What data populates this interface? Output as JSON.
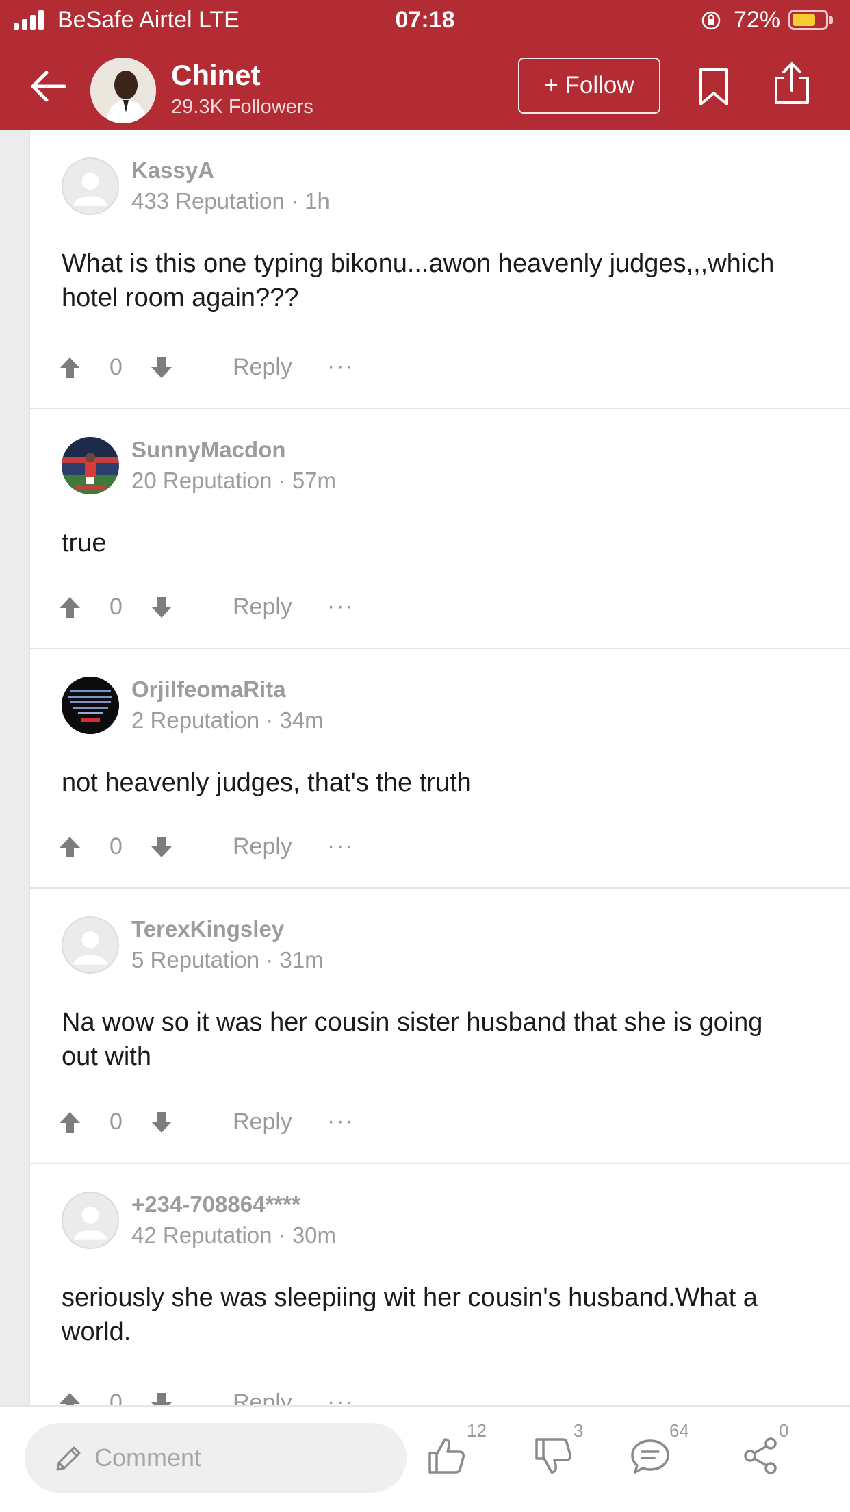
{
  "status_bar": {
    "carrier": "BeSafe Airtel  LTE",
    "time": "07:18",
    "battery": "72%",
    "battery_level": 0.72
  },
  "header": {
    "author": "Chinet",
    "followers": "29.3K Followers",
    "follow_label": "+ Follow",
    "icons": [
      "back-arrow-icon",
      "bookmark-icon",
      "share-icon"
    ]
  },
  "comments": [
    {
      "user": "KassyA",
      "meta": "433 Reputation · 1h",
      "text": "What is this one typing bikonu...awon heavenly judges,,,which hotel room again???",
      "votes": "0",
      "reply": "Reply",
      "more": "···"
    },
    {
      "user": "SunnyMacdon",
      "meta": "20 Reputation · 57m",
      "text": "true",
      "votes": "0",
      "reply": "Reply",
      "more": "···"
    },
    {
      "user": "OrjiIfeomaRita",
      "meta": "2 Reputation · 34m",
      "text": "not heavenly judges, that's the truth",
      "votes": "0",
      "reply": "Reply",
      "more": "···"
    },
    {
      "user": "TerexKingsley",
      "meta": "5 Reputation · 31m",
      "text": "Na wow so it was her cousin sister husband that she is going out with",
      "votes": "0",
      "reply": "Reply",
      "more": "···"
    },
    {
      "user": "+234-708864****",
      "meta": "42 Reputation · 30m",
      "text": "seriously she was sleepiing wit her cousin's husband.What a world.",
      "votes": "0",
      "reply": "Reply",
      "more": "···"
    }
  ],
  "bottom_bar": {
    "comment_placeholder": "Comment",
    "likes": "12",
    "dislikes": "3",
    "comments": "64",
    "shares": "0"
  },
  "colors": {
    "brand": "#b32b33",
    "muted": "#9c9c9c",
    "text": "#1b1b1b"
  }
}
